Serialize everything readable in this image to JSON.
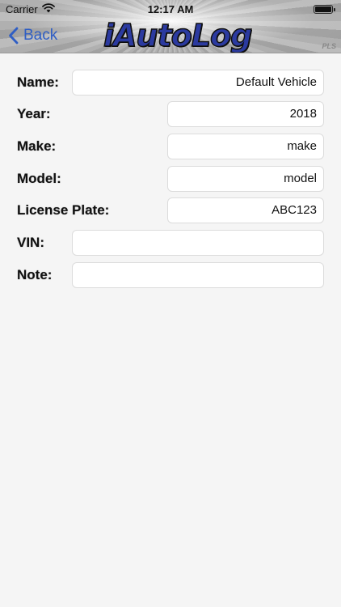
{
  "status": {
    "carrier": "Carrier",
    "time": "12:17 AM"
  },
  "nav": {
    "back_label": "Back",
    "logo_text": "iAutoLog",
    "logo_suffix": "PLS"
  },
  "form": {
    "name": {
      "label": "Name:",
      "value": "Default Vehicle"
    },
    "year": {
      "label": "Year:",
      "value": "2018"
    },
    "make": {
      "label": "Make:",
      "value": "make"
    },
    "model": {
      "label": "Model:",
      "value": "model"
    },
    "license_plate": {
      "label": "License Plate:",
      "value": "ABC123"
    },
    "vin": {
      "label": "VIN:",
      "value": ""
    },
    "note": {
      "label": "Note:",
      "value": ""
    }
  },
  "colors": {
    "accent": "#2f5ec4",
    "background": "#f5f5f5"
  }
}
